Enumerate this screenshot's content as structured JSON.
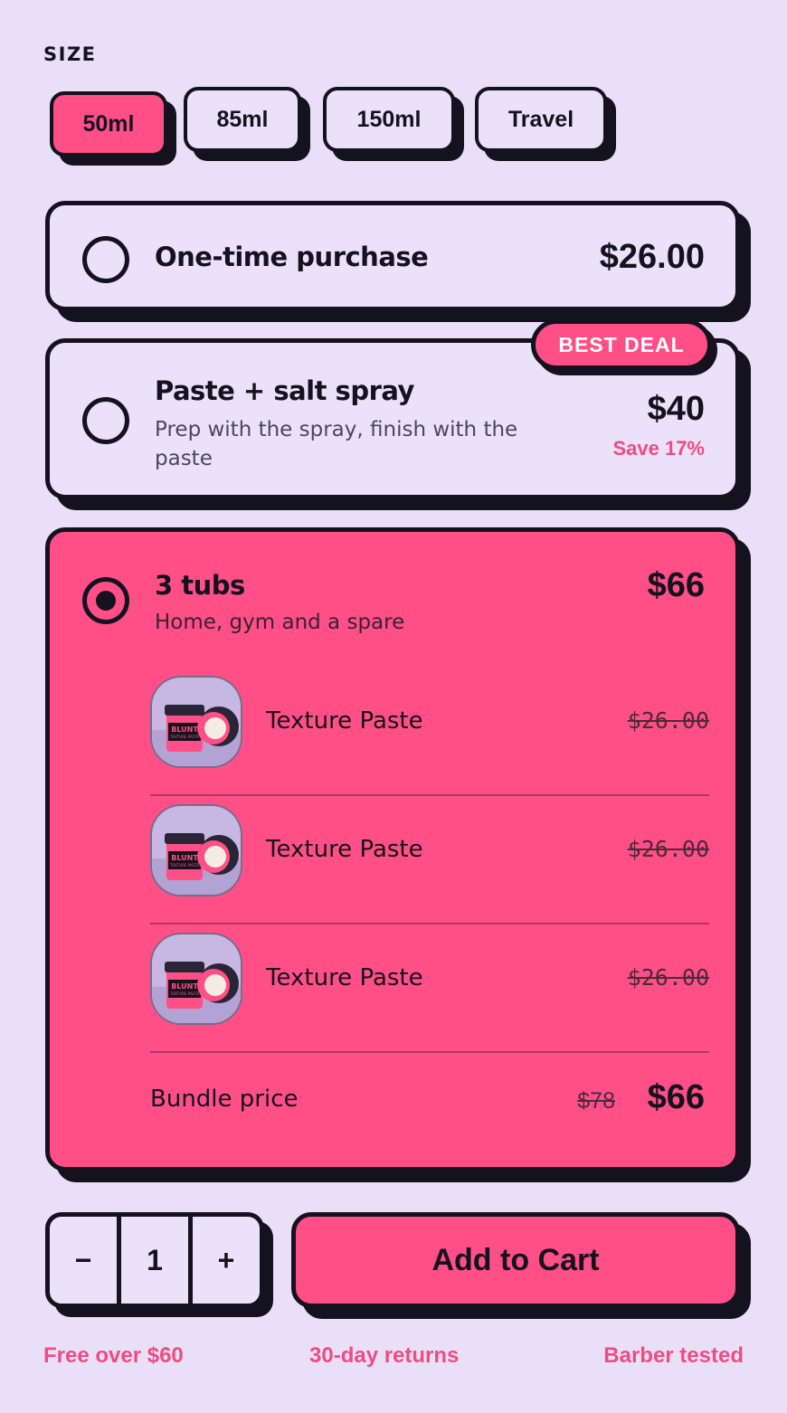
{
  "size": {
    "label": "SIZE",
    "options": [
      "50ml",
      "85ml",
      "150ml",
      "Travel"
    ],
    "selected": "50ml"
  },
  "options": [
    {
      "title": "One-time purchase",
      "price": "$26.00",
      "selected": false
    },
    {
      "title": "Paste + salt spray",
      "description": "Prep with the spray, finish with the paste",
      "price": "$40",
      "save": "Save 17%",
      "badge": "BEST DEAL",
      "selected": false
    },
    {
      "title": "3 tubs",
      "description": "Home, gym and a spare",
      "price": "$66",
      "selected": true,
      "items": [
        {
          "name": "Texture Paste",
          "price": "$26.00"
        },
        {
          "name": "Texture Paste",
          "price": "$26.00"
        },
        {
          "name": "Texture Paste",
          "price": "$26.00"
        }
      ],
      "bundle": {
        "label": "Bundle price",
        "old_price": "$78",
        "new_price": "$66"
      }
    }
  ],
  "product_label": {
    "brand": "BLUNT",
    "sub": "TEXTURE PASTE"
  },
  "quantity": {
    "minus": "−",
    "value": "1",
    "plus": "+"
  },
  "cart": {
    "label": "Add to Cart"
  },
  "perks": [
    "Free over $60",
    "30-day returns",
    "Barber tested"
  ],
  "colors": {
    "background": "#e9e0f8",
    "accent": "#ff4f86",
    "ink": "#15121f",
    "accent_text": "#f24b82"
  }
}
